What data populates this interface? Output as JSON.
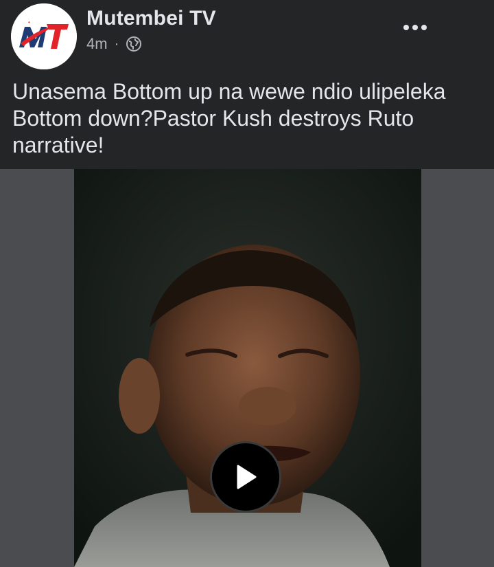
{
  "post": {
    "author": {
      "name": "Mutembei TV",
      "logo_text": "MT",
      "logo_colors": {
        "accent": "#e2232a",
        "dark": "#1f3b73"
      }
    },
    "time": "4m",
    "separator": "·",
    "privacy_icon": "globe-icon",
    "more_icon": "more-dots-icon",
    "caption": "Unasema Bottom up na wewe ndio ulipeleka Bottom down?Pastor Kush destroys Ruto narrative!",
    "video": {
      "play_icon": "play-icon"
    }
  },
  "colors": {
    "background": "#242526",
    "primary_text": "#e4e6eb",
    "secondary_text": "#b0b3b8",
    "video_letterbox": "#4b4c4f"
  }
}
